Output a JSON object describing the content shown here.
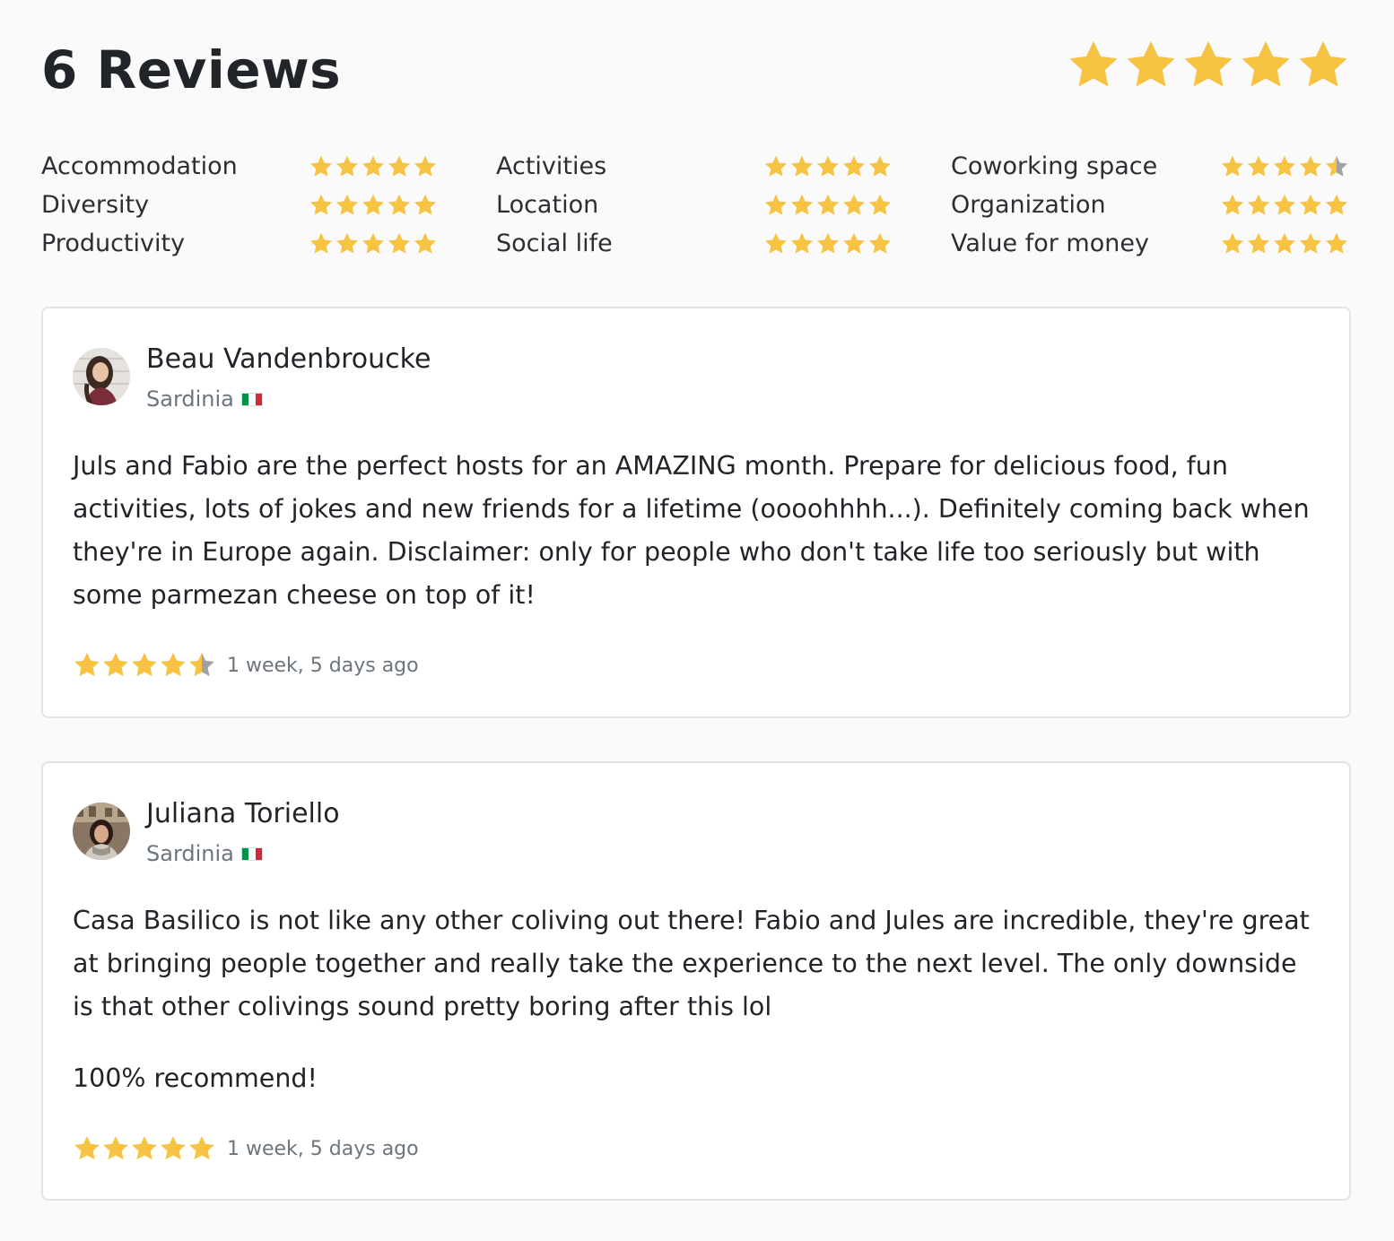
{
  "header": {
    "title": "6 Reviews",
    "overall_rating": 5
  },
  "colors": {
    "star_filled": "#f6c343",
    "star_empty": "#a1a1a1",
    "text_muted": "#6c757d"
  },
  "categories": [
    [
      {
        "label": "Accommodation",
        "rating": 5
      },
      {
        "label": "Diversity",
        "rating": 5
      },
      {
        "label": "Productivity",
        "rating": 5
      }
    ],
    [
      {
        "label": "Activities",
        "rating": 5
      },
      {
        "label": "Location",
        "rating": 5
      },
      {
        "label": "Social life",
        "rating": 5
      }
    ],
    [
      {
        "label": "Coworking space",
        "rating": 4.5
      },
      {
        "label": "Organization",
        "rating": 5
      },
      {
        "label": "Value for money",
        "rating": 5
      }
    ]
  ],
  "reviews": [
    {
      "author": "Beau Vandenbroucke",
      "location": "Sardinia",
      "flag": "italy-flag-icon",
      "paragraphs": [
        "Juls and Fabio are the perfect hosts for an AMAZING month. Prepare for delicious food, fun activities, lots of jokes and new friends for a lifetime (oooohhhh...). Definitely coming back when they're in Europe again. Disclaimer: only for people who don't take life too seriously but with some parmezan cheese on top of it!"
      ],
      "rating": 4.5,
      "date": "1 week, 5 days ago"
    },
    {
      "author": "Juliana Toriello",
      "location": "Sardinia",
      "flag": "italy-flag-icon",
      "paragraphs": [
        "Casa Basilico is not like any other coliving out there! Fabio and Jules are incredible, they're great at bringing people together and really take the experience to the next level. The only downside is that other colivings sound pretty boring after this lol",
        "100% recommend!"
      ],
      "rating": 5,
      "date": "1 week, 5 days ago"
    }
  ]
}
